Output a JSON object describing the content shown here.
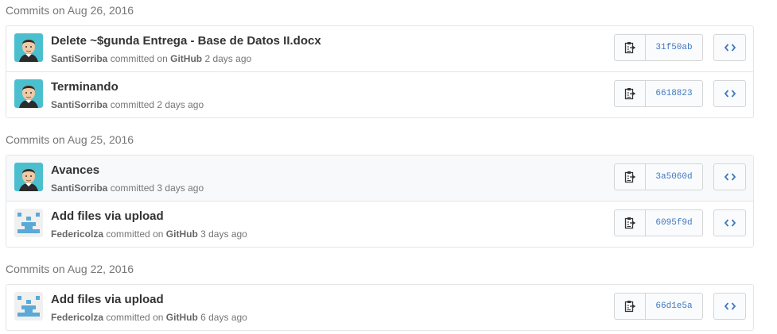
{
  "groups": [
    {
      "title": "Commits on Aug 26, 2016",
      "commits": [
        {
          "message": "Delete ~$gunda Entrega - Base de Datos II.docx",
          "author": "SantiSorriba",
          "verb": "committed",
          "via_prefix": "on",
          "via": "GitHub",
          "time": "2 days ago",
          "sha": "31f50ab",
          "avatar": "person-avatar"
        },
        {
          "message": "Terminando",
          "author": "SantiSorriba",
          "verb": "committed",
          "via_prefix": "",
          "via": "",
          "time": "2 days ago",
          "sha": "6618823",
          "avatar": "person-avatar"
        }
      ]
    },
    {
      "title": "Commits on Aug 25, 2016",
      "commits": [
        {
          "message": "Avances",
          "author": "SantiSorriba",
          "verb": "committed",
          "via_prefix": "",
          "via": "",
          "time": "3 days ago",
          "sha": "3a5060d",
          "avatar": "person-avatar"
        },
        {
          "message": "Add files via upload",
          "author": "Federicolza",
          "verb": "committed",
          "via_prefix": "on",
          "via": "GitHub",
          "time": "3 days ago",
          "sha": "6095f9d",
          "avatar": "identicon-avatar"
        }
      ]
    },
    {
      "title": "Commits on Aug 22, 2016",
      "commits": [
        {
          "message": "Add files via upload",
          "author": "Federicolza",
          "verb": "committed",
          "via_prefix": "on",
          "via": "GitHub",
          "time": "6 days ago",
          "sha": "66d1e5a",
          "avatar": "identicon-avatar"
        }
      ]
    }
  ],
  "icons": {
    "copy": "clipboard-icon",
    "browse": "code-icon"
  },
  "colors": {
    "sha": "#4078c0",
    "border": "#e5e5e5",
    "identicon": "#5aa9d6"
  }
}
